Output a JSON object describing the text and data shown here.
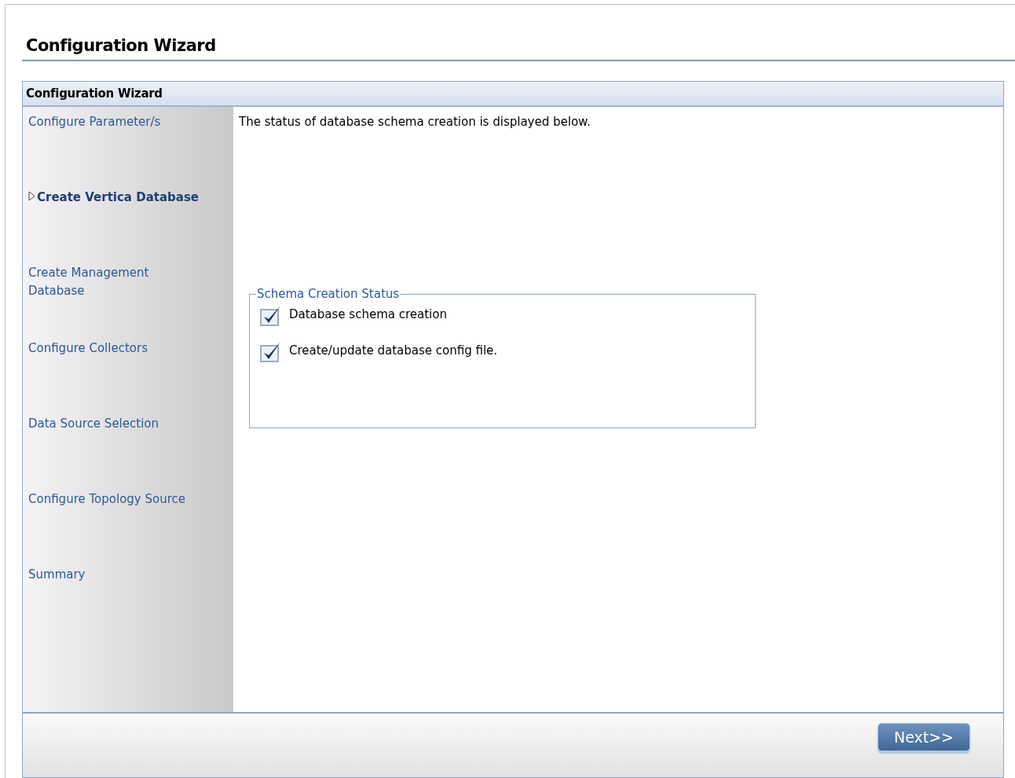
{
  "page_title": "Configuration Wizard",
  "panel": {
    "title": "Configuration Wizard"
  },
  "steps": [
    {
      "label": "Configure Parameter/s",
      "selected": false
    },
    {
      "label": "Create Vertica Database",
      "selected": true
    },
    {
      "label": "Create Management Database",
      "selected": false
    },
    {
      "label": "Configure Collectors",
      "selected": false
    },
    {
      "label": "Data Source Selection",
      "selected": false
    },
    {
      "label": "Configure Topology Source",
      "selected": false
    },
    {
      "label": "Summary",
      "selected": false
    }
  ],
  "intro": "The status of database schema creation is displayed below.",
  "status_group": {
    "legend": "Schema Creation Status",
    "items": [
      {
        "label": "Database schema creation",
        "checked": true
      },
      {
        "label": "Create/update database config file.",
        "checked": true
      }
    ]
  },
  "buttons": [
    {
      "label": "Next>>"
    }
  ]
}
